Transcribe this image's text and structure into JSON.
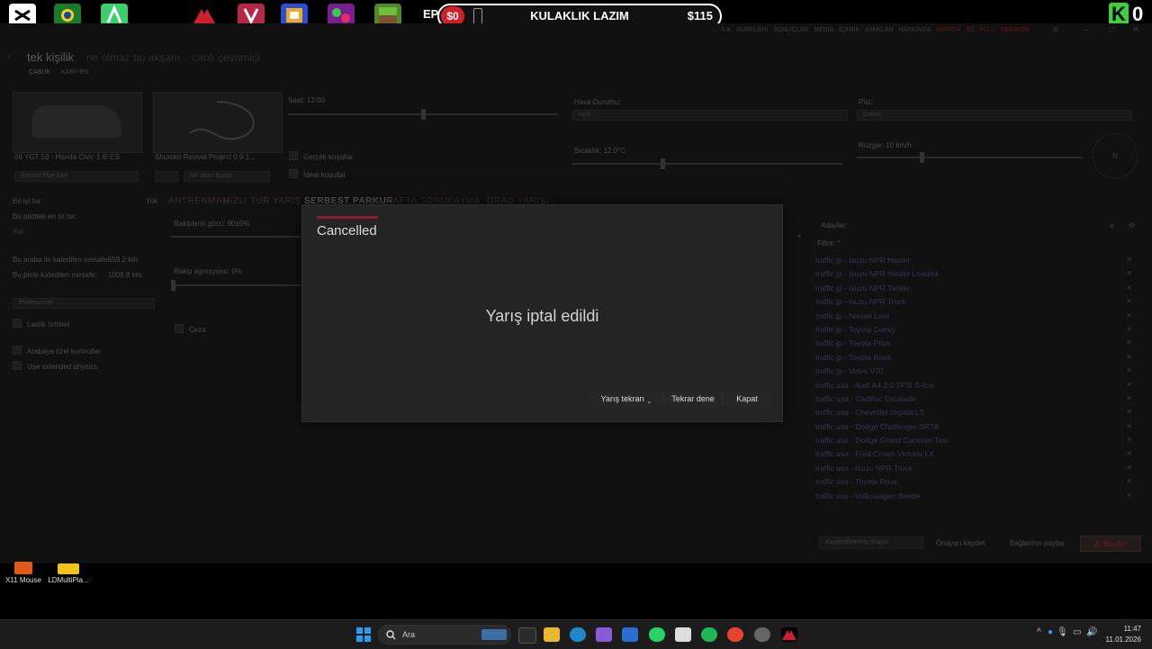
{
  "overlay": {
    "promo_left": "$0",
    "promo_title": "KULAKLIK LAZIM",
    "promo_amount": "$115",
    "badge_letter": "K",
    "badge_count": "0",
    "epic_label": "EPI"
  },
  "app": {
    "nav": [
      "...",
      "İLK SÜRELERİ",
      "SONUÇLAR",
      "MEDIA",
      "İÇERİK",
      "AYARLAR",
      "HAKKINDA"
    ],
    "nav_switch": "SWITCH TO FULL VERSION",
    "page_title": "tek kişilik",
    "page_sub": "ne olmaz bu akşam... canlı çevrimiçi",
    "subtabs": [
      "ÇABUK",
      "KARİYER"
    ],
    "car_caption": "06 YGT 53 - Honda Civic 1.6i ES",
    "car_skin": "Eternal Blue Met",
    "track_caption": "Shutoko Revival Project 0.9.1...",
    "track_layout": "No skins found",
    "time_label": "Saat: 12:00",
    "weather_label": "Hava Durumu:",
    "weather_value": "Açık",
    "pist_label": "Pist:",
    "pist_value": "Green",
    "realistic_tyres": "Gerçek koşullar",
    "ideal_conditions": "İdeal koşullar",
    "temp_label": "Sıcaklık: 12.0°C",
    "wind_label": "Rüzgar: 10 km/h",
    "compass": "N",
    "best_lap": "En iyi tur:",
    "best_lap_val": "Yok",
    "best_track": "Bu pistteki en iyi tur:",
    "best_track_val": "Yok",
    "car_dist_label": "Bu araba ile katedilen mesafe:",
    "car_dist": "659.2 km",
    "track_dist_label": "Bu piste katedilen mesafe:",
    "track_dist": "1008.8 km",
    "difficulty": "Profesyonel",
    "opt_tyres": "Lastik örtüleri",
    "opt_car_controls": "Arabaya özel kontroller",
    "opt_physics": "Use extended physics",
    "modes": [
      "ANTRENMAN",
      "HIZLI TUR",
      "YARIŞ",
      "SERBEST PARKUR",
      "HAFTA SONU",
      "KAYMA",
      "DRAG YARIŞI"
    ],
    "active_mode": "SERBEST PARKUR",
    "opp_strength": "Rakiplerin gücü: 90±5%",
    "opp_aggr": "Rakip agresyonu: 0%",
    "penalty": "Ceza",
    "opponents_label": "Adaylar:",
    "filter_label": "Filtre: *",
    "opponents": [
      "traffic jp - Isuzu NPR Hauler",
      "traffic jp - Isuzu NPR Hauler Loaded",
      "traffic jp - Isuzu NPR Tanker",
      "traffic jp - Isuzu NPR Truck",
      "traffic jp - Nissan Leaf",
      "traffic jp - Toyota Camry",
      "traffic jp - Toyota Prius",
      "traffic jp - Toyota Rav4",
      "traffic jp - Volvo V70",
      "traffic usa - Audi A4 2.0 TFSI S-line",
      "traffic usa - Cadillac Escalade",
      "traffic usa - Chevrolet Impala LS",
      "traffic usa - Dodge Challenger SRT8",
      "traffic usa - Dodge Grand Caravan Taxi",
      "traffic usa - Ford Crown Victoria LX",
      "traffic usa - Isuzu NPR Truck",
      "traffic usa - Toyota Prius",
      "traffic usa - Volkswagen Beetle"
    ],
    "preset": "Kaydedilmemiş önayar",
    "save_preset": "Önayarı kaydet",
    "share_link": "Bağlantıyı paylaş",
    "start": "Başla!"
  },
  "modal": {
    "title": "Cancelled",
    "message": "Yarış iptal edildi",
    "replay": "Yarış tekrarı",
    "retry": "Tekrar dene",
    "close": "Kapat"
  },
  "desktop": {
    "icon1": "X11 Mouse",
    "icon2": "LDMultiPla..."
  },
  "taskbar": {
    "search_placeholder": "Ara",
    "time": "11:47",
    "date": "11.01.2026"
  },
  "colors": {
    "accent": "#8d1a2c",
    "start_red": "#9c1f1f",
    "promo_red": "#d2202b",
    "badge_green": "#3ecf3e"
  }
}
